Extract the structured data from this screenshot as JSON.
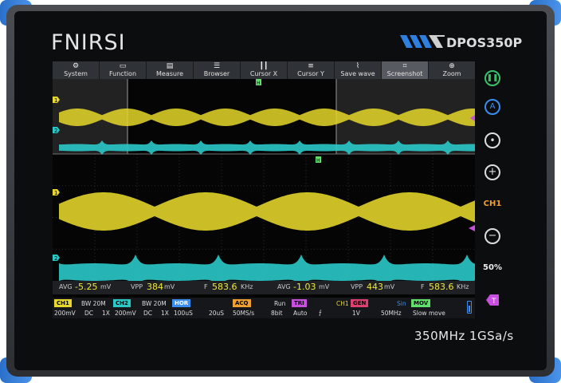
{
  "device": {
    "brand": "FNIRSI",
    "model": "DPOS350P",
    "spec": "350MHz  1GSa/s"
  },
  "menu": [
    {
      "label": "System",
      "icon": "gear-icon"
    },
    {
      "label": "Function",
      "icon": "monitor-icon"
    },
    {
      "label": "Measure",
      "icon": "ruler-icon"
    },
    {
      "label": "Browser",
      "icon": "database-icon"
    },
    {
      "label": "Cursor X",
      "icon": "cursor-x-icon"
    },
    {
      "label": "Cursor Y",
      "icon": "cursor-y-icon"
    },
    {
      "label": "Save wave",
      "icon": "wave-save-icon"
    },
    {
      "label": "Screenshot",
      "icon": "crop-icon"
    },
    {
      "label": "Zoom",
      "icon": "zoom-icon"
    }
  ],
  "measurements": {
    "ch1_avg_label": "AVG",
    "ch1_avg": "-5.25",
    "ch1_avg_unit": "mV",
    "ch1_vpp_label": "VPP",
    "ch1_vpp": "384",
    "ch1_vpp_unit": "mV",
    "ch1_f_label": "F",
    "ch1_f": "583.6",
    "ch1_f_unit": "KHz",
    "ch2_avg_label": "AVG",
    "ch2_avg": "-1.03",
    "ch2_avg_unit": "mV",
    "ch2_vpp_label": "VPP",
    "ch2_vpp": "443",
    "ch2_vpp_unit": "mV",
    "ch2_f_label": "F",
    "ch2_f": "583.6",
    "ch2_f_unit": "KHz"
  },
  "status": {
    "ch1": {
      "tag": "CH1",
      "bw": "BW 20M",
      "volts": "200mV",
      "coupling": "DC",
      "probe": "1X"
    },
    "ch2": {
      "tag": "CH2",
      "bw": "BW 20M",
      "volts": "200mV",
      "coupling": "DC",
      "probe": "1X"
    },
    "hor": {
      "tag": "HOR",
      "value": "100uS",
      "value2": "20uS"
    },
    "acq": {
      "tag": "ACQ",
      "mode": "Run",
      "rate": "50MS/s",
      "bits": "8bit"
    },
    "tri": {
      "tag": "TRI",
      "mode": "Auto",
      "source": "CH1",
      "edge": "⨍"
    },
    "gen": {
      "tag": "GEN",
      "wave": "Sin",
      "amp": "1V",
      "freq": "50MHz"
    },
    "mov": {
      "tag": "MOV",
      "mode": "Slow move"
    }
  },
  "side_buttons": {
    "run": "run-pause-icon",
    "auto": "A",
    "select": "select-icon",
    "plus": "+",
    "channel": "CH1",
    "minus": "−",
    "percent": "50%"
  },
  "markers": {
    "ch1": "1",
    "ch2": "2",
    "trigger_top": "H",
    "trigger_mid": "H",
    "level": "T"
  },
  "colors": {
    "ch1": "#e6d72a",
    "ch2": "#2bc8c8",
    "acq": "#f0a030",
    "tri": "#c94fe0",
    "gen": "#e04070",
    "mov": "#5ee06a",
    "hor": "#3a8ef0"
  }
}
